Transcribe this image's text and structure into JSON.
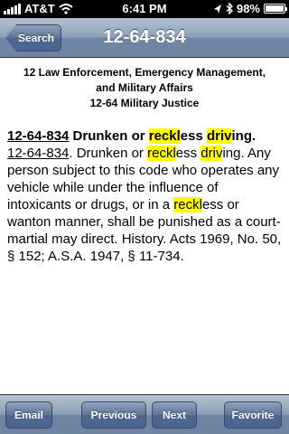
{
  "status_bar": {
    "carrier": "AT&T",
    "time": "6:41 PM",
    "battery_percent": "98%",
    "battery_level": 0.98,
    "icons": [
      "signal-bars",
      "wifi",
      "location-arrow",
      "bluetooth",
      "battery"
    ]
  },
  "nav": {
    "back_label": "Search",
    "title": "12-64-834"
  },
  "content": {
    "heading_line1": "12 Law Enforcement, Emergency Management,",
    "heading_line2": "and Military Affairs",
    "heading_line3": "12-64 Military Justice",
    "section_number": "12-64-834",
    "title_part1": " Drunken or ",
    "title_hl1": "reckl",
    "title_part2": "ess ",
    "title_hl2": "driv",
    "title_part3": "ing.",
    "body_number": "12-64-834",
    "body_part1": ". Drunken or ",
    "body_hl1": "reckl",
    "body_part2": "ess ",
    "body_hl2": "driv",
    "body_part3": "ing. Any person subject to this code who operates any vehicle while under the influence of intoxicants or drugs, or in a ",
    "body_hl3": "reckl",
    "body_part4": "ess or wanton manner, shall be punished as a court-martial may direct.",
    "history": "History. Acts 1969, No. 50, § 152; A.S.A. 1947, § 11-734."
  },
  "toolbar": {
    "email_label": "Email",
    "previous_label": "Previous",
    "next_label": "Next",
    "favorite_label": "Favorite"
  },
  "colors": {
    "highlight": "#ffff00",
    "bar_blue": "#6d84a2",
    "button_blue": "#4a6590"
  }
}
